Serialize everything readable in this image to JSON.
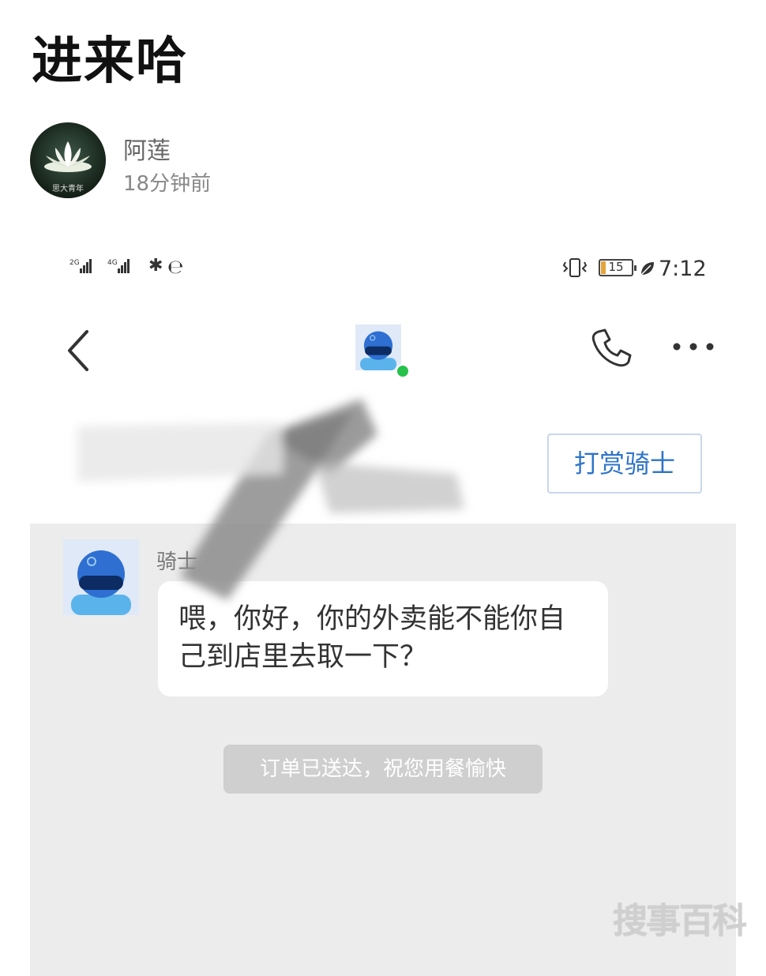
{
  "post": {
    "title": "进来哈",
    "author_name": "阿莲",
    "time_ago": "18分钟前",
    "avatar_caption": "思大青年"
  },
  "status_bar": {
    "signal1_label": "2G",
    "signal2_label": "4G",
    "battery_level": "15",
    "battery_color": "#e3a53a",
    "time": "7:12"
  },
  "chat": {
    "tip_button_label": "打赏骑士",
    "sender_label": "骑士",
    "message": "喂，你好，你的外卖能不能你自己到店里去取一下？",
    "system_notice": "订单已送达，祝您用餐愉快",
    "online_color": "#27c24c",
    "accent_color": "#2f74c8"
  },
  "watermark": "搜事百科",
  "icons": [
    "back-icon",
    "phone-icon",
    "more-icon",
    "bluetooth-icon",
    "vibrate-icon",
    "battery-icon",
    "leaf-icon",
    "helmet-icon"
  ]
}
